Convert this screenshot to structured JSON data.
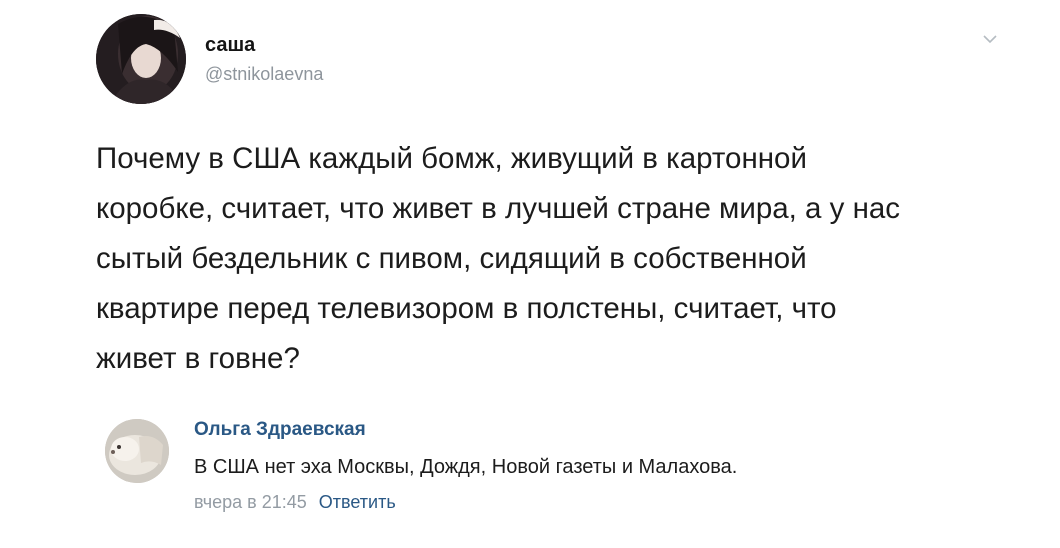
{
  "post": {
    "author_name": "саша",
    "author_handle": "@stnikolaevna",
    "text_lines": [
      "Почему в США каждый бомж, живущий в картонной",
      "коробке, считает, что живет в лучшей стране мира, а у нас",
      "сытый бездельник с пивом, сидящий в собственной",
      "квартире перед телевизором в полстены, считает, что",
      "живет в  говне?"
    ],
    "menu_icon": "chevron-down-icon"
  },
  "comment": {
    "author_name": "Ольга Здраевская",
    "text": "В США нет эха Москвы, Дождя, Новой газеты и Малахова.",
    "time": "вчера в 21:45",
    "reply_label": "Ответить"
  },
  "colors": {
    "link": "#2a5885",
    "muted": "#939ba3",
    "text": "#1c1c1c"
  }
}
